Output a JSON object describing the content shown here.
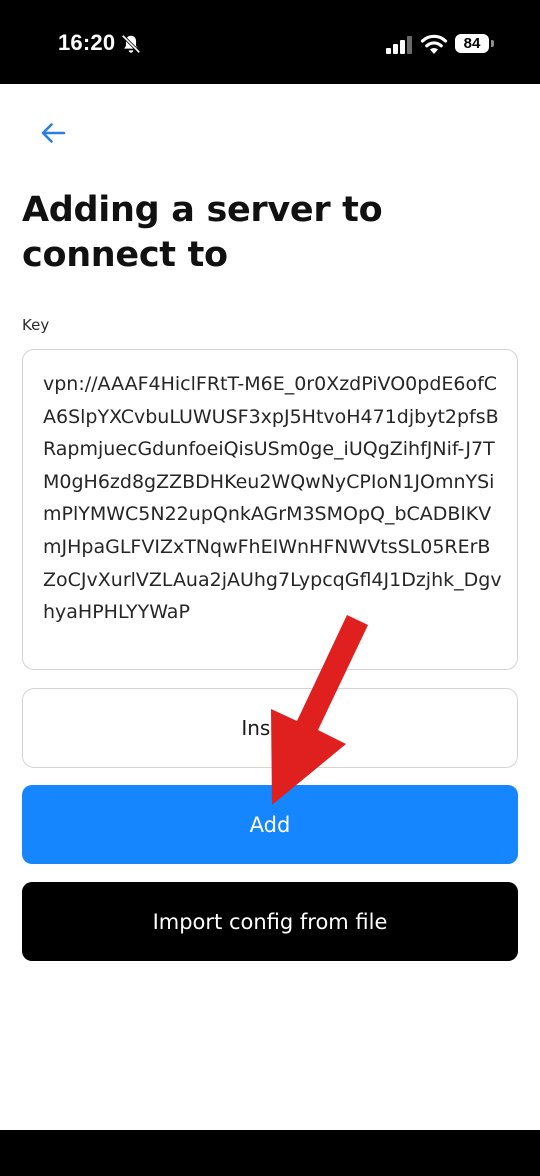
{
  "status_bar": {
    "time": "16:20",
    "battery": "84",
    "icons": [
      "bell-slash-icon",
      "signal-icon",
      "wifi-icon",
      "battery-icon"
    ]
  },
  "nav": {
    "back_icon": "arrow-left-icon"
  },
  "page": {
    "title": "Adding a server to connect to"
  },
  "form": {
    "key_label": "Key",
    "key_value": "vpn://AAAF4HiclFRtT-M6E_0r0XzdPiVO0pdE6ofCA6SlpYXCvbuLUWUSF3xpJ5HtvoH471djbyt2pfsBRapmjuecGdunfoeiQisUSm0ge_iUQgZihfJNif-J7TM0gH6zd8gZZBDHKeu2WQwNyCPIoN1JOmnYSimPlYMWC5N22upQnkAGrM3SMOpQ_bCADBlKVmJHpaGLFVIZxTNqwFhEIWnHFNWVtsSL05RErBZoCJvXurlVZLAua2jAUhg7LypcqGfl4J1Dzjhk_DgvhyaHPHLYYWaP"
  },
  "buttons": {
    "insert": "Insert",
    "add": "Add",
    "import": "Import config from file"
  },
  "colors": {
    "accent": "#1686ff",
    "back_arrow": "#2b7fe0",
    "annotation_arrow": "#e0201f"
  }
}
